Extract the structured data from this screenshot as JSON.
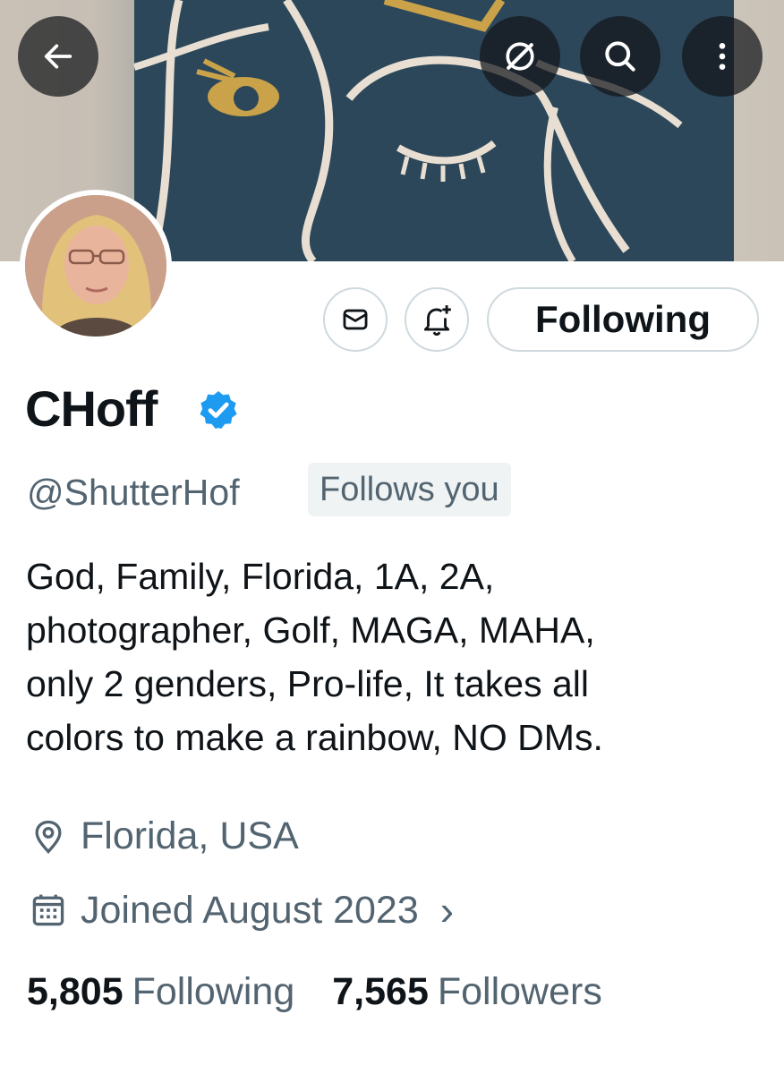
{
  "header": {
    "back_icon": "arrow-left-icon",
    "grok_icon": "grok-icon",
    "search_icon": "search-icon",
    "more_icon": "more-vertical-icon"
  },
  "actions": {
    "message_icon": "envelope-icon",
    "notify_icon": "bell-plus-icon",
    "follow_label": "Following"
  },
  "profile": {
    "display_name": "CHoff",
    "verified_color": "#1d9bf0",
    "handle": "@ShutterHof",
    "follows_you": "Follows you",
    "bio": "God, Family, Florida, 1A, 2A,\nphotographer, Golf, MAGA, MAHA,\nonly 2 genders, Pro-life, It takes all\ncolors to make a rainbow, NO DMs.",
    "location": "Florida, USA",
    "joined": "Joined August 2023",
    "joined_chevron": "›"
  },
  "stats": {
    "following_count": "5,805",
    "following_label": "Following",
    "followers_count": "7,565",
    "followers_label": "Followers"
  },
  "colors": {
    "text_primary": "#0f1419",
    "text_secondary": "#536471",
    "border": "#cfd9de"
  }
}
